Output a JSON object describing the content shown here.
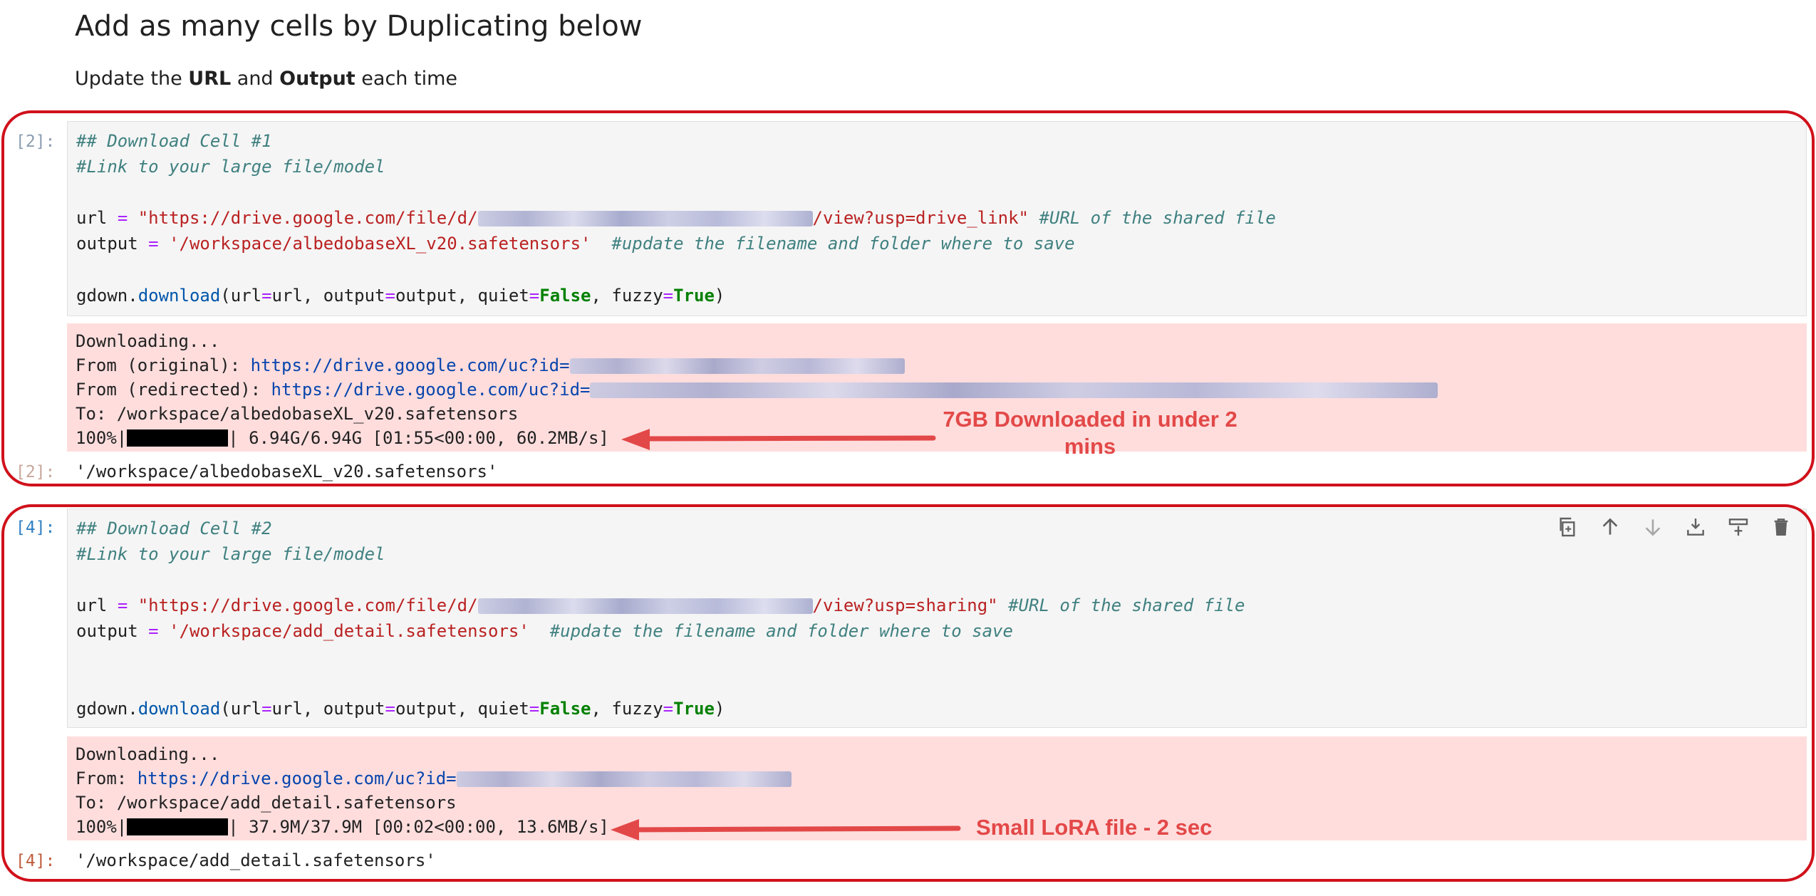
{
  "markdown": {
    "heading": "Add as many cells by Duplicating below",
    "para_prefix": "Update the ",
    "para_bold1": "URL",
    "para_mid": " and ",
    "para_bold2": "Output",
    "para_suffix": " each time"
  },
  "cell1": {
    "in_prompt": "[2]:",
    "out_prompt": "[2]:",
    "code": {
      "line1": "## Download Cell #1",
      "line2": "#Link to your large file/model",
      "url_var": "url",
      "url_eq": "=",
      "url_str_start": "\"https://drive.google.com/file/d/",
      "url_str_end": "/view?usp=drive_link\"",
      "url_comment": "#URL of the shared file",
      "output_var": "output",
      "output_eq": "=",
      "output_str": "'/workspace/albedobaseXL_v20.safetensors'",
      "output_comment": "#update the filename and folder where to save",
      "call_obj": "gdown.",
      "call_fn": "download",
      "call_open": "(url",
      "call_eq1": "=",
      "call_arg1": "url, output",
      "call_eq2": "=",
      "call_arg2": "output, quiet",
      "call_eq3": "=",
      "call_false": "False",
      "call_arg3": ", fuzzy",
      "call_eq4": "=",
      "call_true": "True",
      "call_close": ")"
    },
    "stderr": {
      "line1": "Downloading...",
      "from_orig_label": "From (original): ",
      "from_orig_link": "https://drive.google.com/uc?id=",
      "from_redir_label": "From (redirected): ",
      "from_redir_link": "https://drive.google.com/uc?id=",
      "to_line": "To: /workspace/albedobaseXL_v20.safetensors",
      "progress_pct": "100%|",
      "progress_rest": "| 6.94G/6.94G [01:55<00:00, 60.2MB/s]"
    },
    "result": "'/workspace/albedobaseXL_v20.safetensors'",
    "annotation": "7GB Downloaded in under 2 mins"
  },
  "cell2": {
    "in_prompt": "[4]:",
    "out_prompt": "[4]:",
    "code": {
      "line1": "## Download Cell #2",
      "line2": "#Link to your large file/model",
      "url_var": "url",
      "url_eq": "=",
      "url_str_start": "\"https://drive.google.com/file/d/",
      "url_str_end": "/view?usp=sharing\"",
      "url_comment": "#URL of the shared file",
      "output_var": "output",
      "output_eq": "=",
      "output_str": "'/workspace/add_detail.safetensors'",
      "output_comment": "#update the filename and folder where to save",
      "call_obj": "gdown.",
      "call_fn": "download",
      "call_open": "(url",
      "call_eq1": "=",
      "call_arg1": "url, output",
      "call_eq2": "=",
      "call_arg2": "output, quiet",
      "call_eq3": "=",
      "call_false": "False",
      "call_arg3": ", fuzzy",
      "call_eq4": "=",
      "call_true": "True",
      "call_close": ")"
    },
    "stderr": {
      "line1": "Downloading...",
      "from_label": "From: ",
      "from_link": "https://drive.google.com/uc?id=",
      "to_line": "To: /workspace/add_detail.safetensors",
      "progress_pct": "100%|",
      "progress_rest": "| 37.9M/37.9M [00:02<00:00, 13.6MB/s]"
    },
    "result": "'/workspace/add_detail.safetensors'",
    "annotation": "Small LoRA file - 2 sec"
  },
  "toolbar": {
    "icons": [
      "duplicate-icon",
      "move-up-icon",
      "move-down-icon",
      "insert-above-icon",
      "insert-below-icon",
      "delete-icon"
    ]
  },
  "colors": {
    "frame": "#d0111b",
    "annotation": "#e34848",
    "stderr_bg": "#ffdddd",
    "code_bg": "#f5f5f5"
  }
}
